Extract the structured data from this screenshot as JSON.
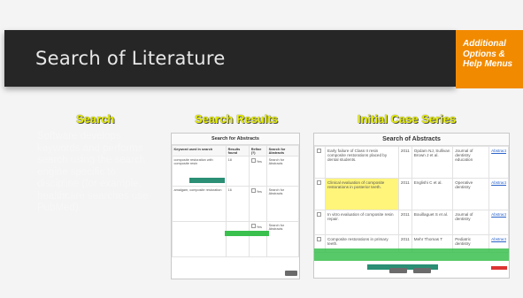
{
  "slide": {
    "title": "Search of Literature",
    "side_note_lines": [
      "Additional",
      "Options &",
      "Help Menus"
    ]
  },
  "columns": {
    "search": {
      "heading": "Search",
      "description": "Software develops keywords and performs search using the search engine specific to discipline (for example, healthcare searches use PubMed)."
    },
    "results": {
      "heading": "Search Results"
    },
    "case_series": {
      "heading": "Initial Case Series"
    }
  },
  "results_shot": {
    "title": "Search for Abstracts",
    "headers": [
      "Keyword used in search",
      "Results found",
      "Refine (?)",
      "Search for Abstracts"
    ],
    "rows": [
      [
        "composite restoration with composite resin",
        "18",
        "Yes",
        "Search for Abstracts"
      ],
      [
        "amalgam, composite restoration",
        "16",
        "Yes",
        "Search for Abstracts"
      ],
      [
        "",
        "",
        "Yes",
        "Search for Abstracts"
      ]
    ]
  },
  "case_shot": {
    "title": "Search of Abstracts",
    "rows": [
      {
        "text": "Early failure of Class II resin composite restorations placed by dental students.",
        "year": "2011",
        "authors": "Opdam NJ, Sullivan Brown J et al.",
        "journal": "Journal of dentistry education",
        "link": "Abstract"
      },
      {
        "text": "Clinical evaluation of composite restorations in posterior teeth.",
        "year": "2011",
        "authors": "Englishi C et al.",
        "journal": "Operative dentistry",
        "link": "Abstract"
      },
      {
        "text": "In vitro evaluation of composite resin repair.",
        "year": "2011",
        "authors": "Bouillaguet S et al.",
        "journal": "Journal of dentistry",
        "link": "Abstract"
      },
      {
        "text": "Composite restorations in primary teeth.",
        "year": "2011",
        "authors": "Mehr Thomas T",
        "journal": "Pediatric dentistry",
        "link": "Abstract"
      }
    ]
  }
}
